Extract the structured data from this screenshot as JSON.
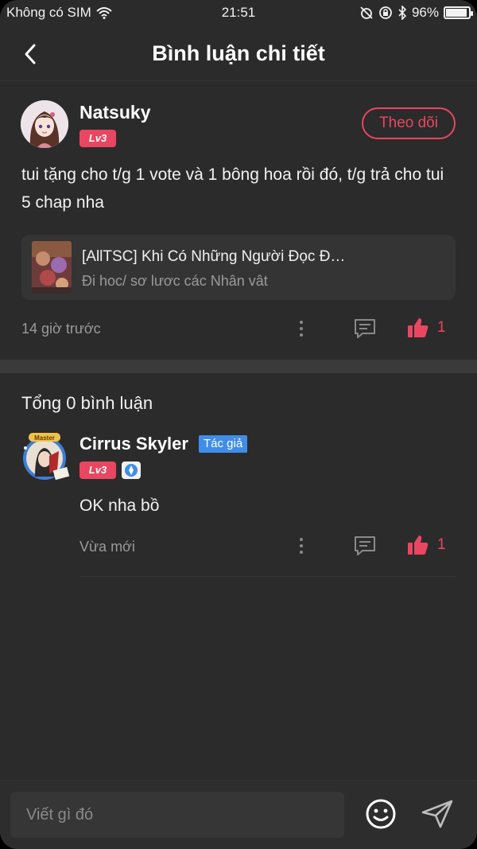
{
  "status_bar": {
    "carrier": "Không có SIM",
    "time": "21:51",
    "battery": "96%"
  },
  "header": {
    "title": "Bình luận chi tiết"
  },
  "post": {
    "username": "Natsuky",
    "level": "Lv3",
    "follow_label": "Theo dõi",
    "content": "tui tặng cho t/g 1 vote và 1 bông hoa rồi đó, t/g trả cho tui 5 chap nha",
    "story": {
      "title": "[AllTSC] Khi Có Những Người Đọc Đ…",
      "subtitle": "Đi hoc/ sơ lươc các Nhân vât"
    },
    "time": "14 giờ trước",
    "likes": "1"
  },
  "comments": {
    "total_label": "Tổng 0 bình luận",
    "items": [
      {
        "username": "Cirrus Skyler",
        "badge": "Tác giả",
        "level": "Lv3",
        "avatar_badge_text": "Master",
        "text": "OK nha bồ",
        "time": "Vừa mới",
        "likes": "1"
      }
    ]
  },
  "composer": {
    "placeholder": "Viết gì đó"
  },
  "colors": {
    "accent": "#e94661",
    "background": "#2b2b2b",
    "author_badge": "#3f8de8"
  }
}
